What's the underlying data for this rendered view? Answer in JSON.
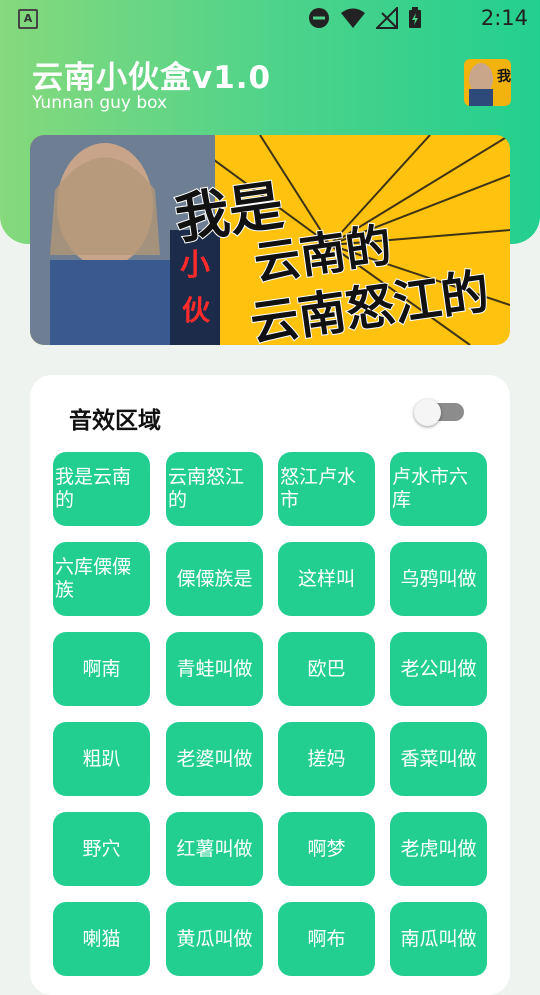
{
  "status_bar": {
    "time": "2:14",
    "app_badge": "A",
    "icons": [
      "do-not-disturb-icon",
      "wifi-icon",
      "no-signal-icon",
      "battery-charging-icon"
    ]
  },
  "header": {
    "title": "云南小伙盒v1.0",
    "subtitle": "Yunnan guy box",
    "avatar_text": "我"
  },
  "banner": {
    "line1": "我是",
    "line2": "云南的",
    "line3": "云南怒江的",
    "badge": "小伙",
    "colors": {
      "background": "#ffc20e",
      "text": "#111111"
    }
  },
  "sound_panel": {
    "title": "音效区域",
    "toggle_on": false,
    "buttons": [
      "我是云南的",
      "云南怒江的",
      "怒江卢水市",
      "卢水市六库",
      "六库傈僳族",
      "傈僳族是",
      "这样叫",
      "乌鸦叫做",
      "啊南",
      "青蛙叫做",
      "欧巴",
      "老公叫做",
      "粗趴",
      "老婆叫做",
      "搓妈",
      "香菜叫做",
      "野穴",
      "红薯叫做",
      "啊梦",
      "老虎叫做",
      "喇猫",
      "黄瓜叫做",
      "啊布",
      "南瓜叫做"
    ]
  },
  "colors": {
    "accent": "#22cf91",
    "header_gradient_start": "#86d97c",
    "header_gradient_end": "#23cf8f"
  }
}
